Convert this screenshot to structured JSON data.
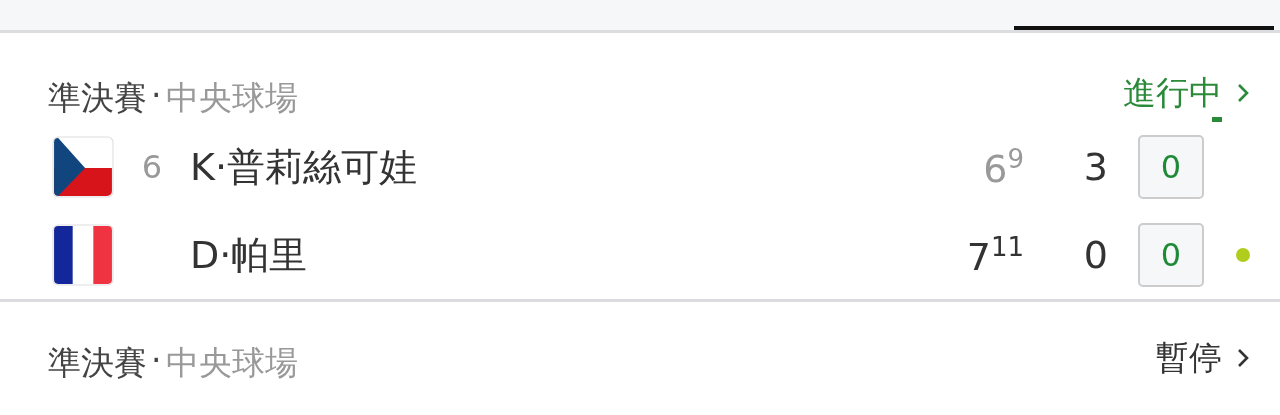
{
  "tabs": [
    {
      "selected": false
    },
    {
      "selected": false
    },
    {
      "selected": false
    },
    {
      "selected": true
    }
  ],
  "matches": [
    {
      "round": "準決賽",
      "separator": "·",
      "court": "中央球場",
      "status": {
        "text": "進行中",
        "kind": "live"
      },
      "players": [
        {
          "flag": {
            "kind": "czech"
          },
          "seed": "6",
          "name": "K·普莉絲可娃",
          "serving": false,
          "sets": [
            {
              "score": "6",
              "tiebreak": "9",
              "kind": "lost"
            },
            {
              "score": "3",
              "kind": "current"
            }
          ],
          "game": "0"
        },
        {
          "flag": {
            "kind": "france"
          },
          "name": "D·帕里",
          "serving": true,
          "sets": [
            {
              "score": "7",
              "tiebreak": "11",
              "kind": "won"
            },
            {
              "score": "0",
              "kind": "current"
            }
          ],
          "game": "0"
        }
      ]
    },
    {
      "round": "準決賽",
      "separator": "·",
      "court": "中央球場",
      "status": {
        "text": "暫停",
        "kind": "paused"
      }
    }
  ]
}
